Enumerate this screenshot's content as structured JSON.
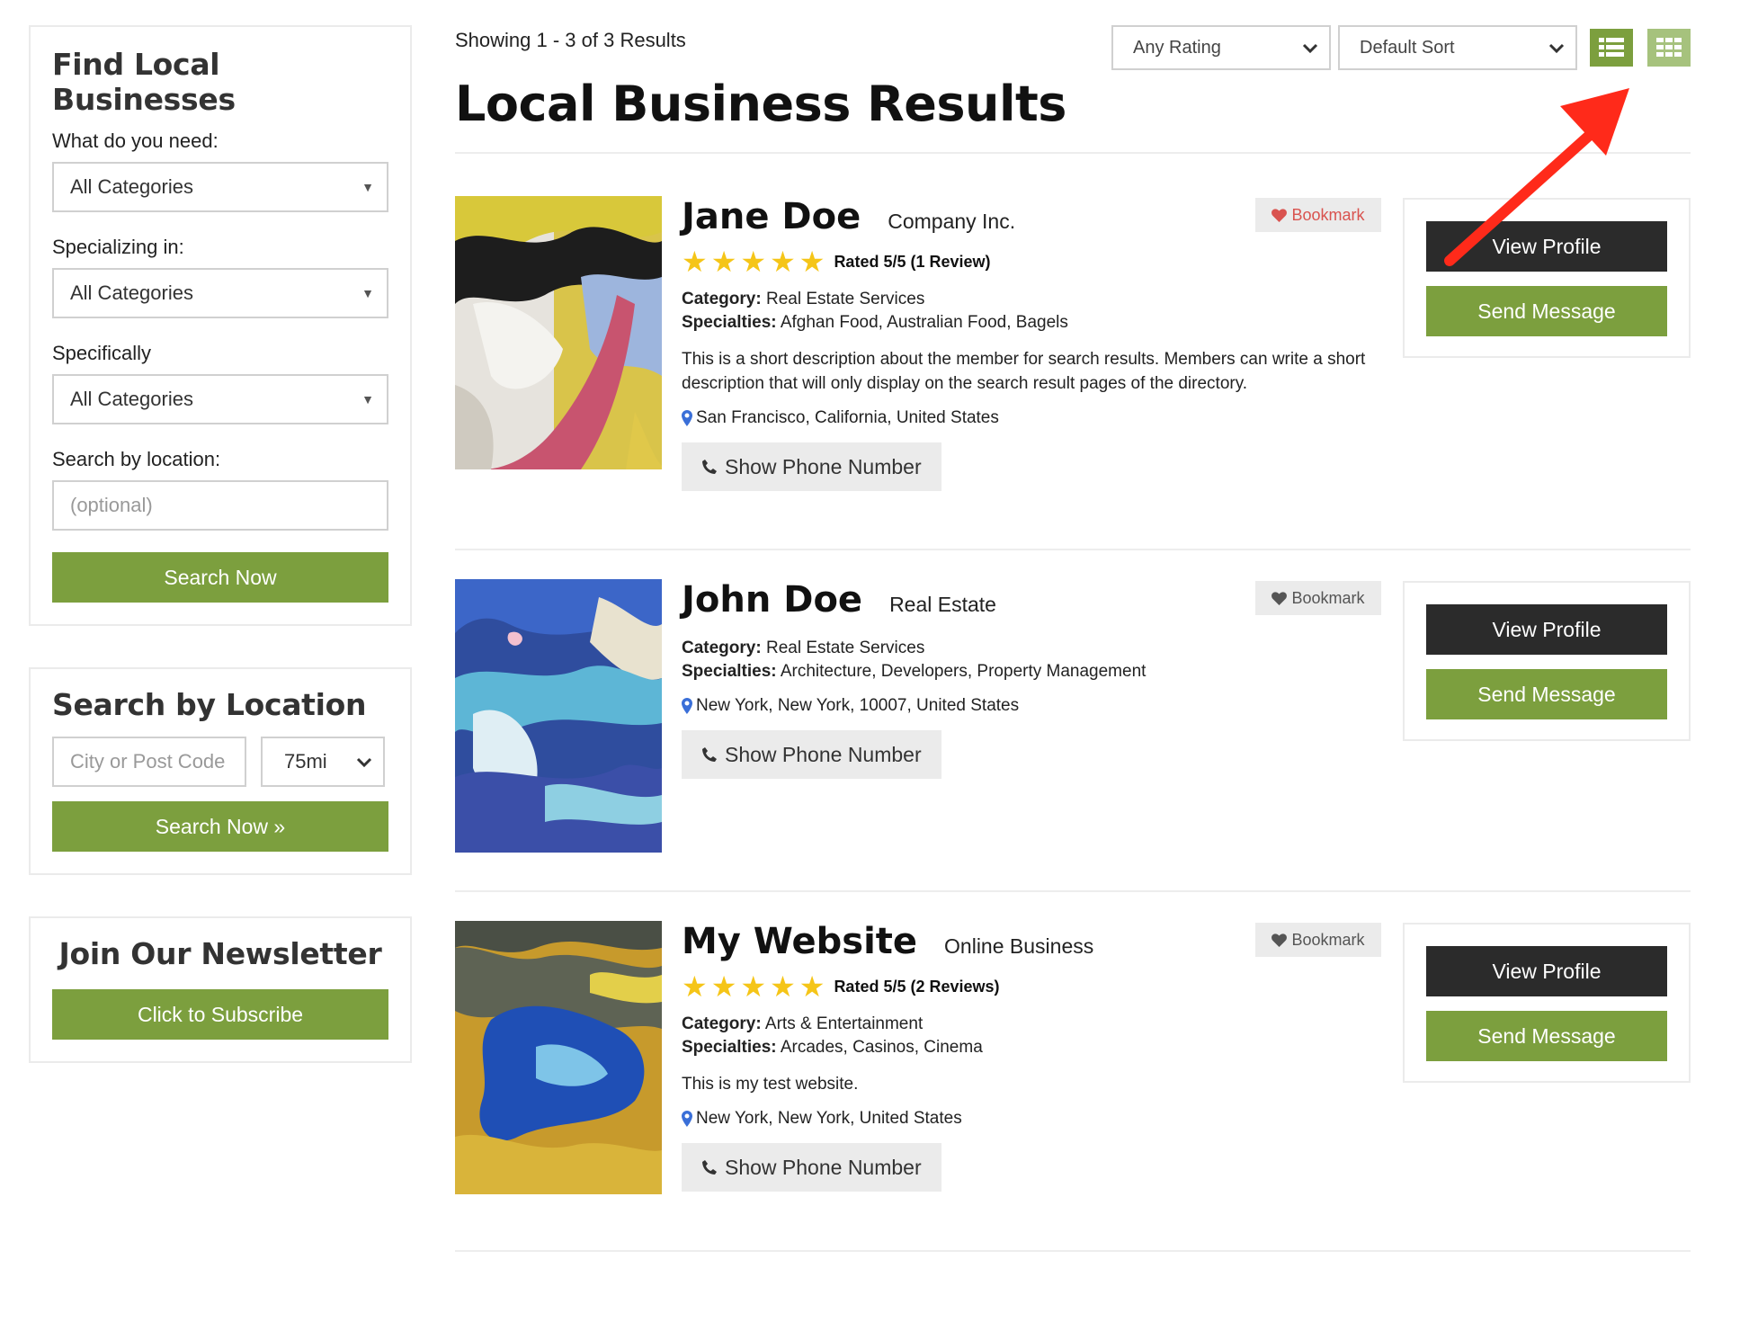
{
  "sidebar": {
    "find": {
      "title": "Find Local Businesses",
      "need_label": "What do you need:",
      "need_value": "All Categories",
      "specializing_label": "Specializing in:",
      "specializing_value": "All Categories",
      "specifically_label": "Specifically",
      "specifically_value": "All Categories",
      "location_label": "Search by location:",
      "location_placeholder": "(optional)",
      "search_button": "Search Now"
    },
    "location": {
      "title": "Search by Location",
      "city_placeholder": "City or Post Code",
      "distance_value": "75mi",
      "search_button": "Search Now »"
    },
    "newsletter": {
      "title": "Join Our Newsletter",
      "subscribe_button": "Click to Subscribe"
    }
  },
  "main": {
    "showing": "Showing 1 - 3 of 3 Results",
    "title": "Local Business Results",
    "rating_filter": "Any Rating",
    "sort_filter": "Default Sort"
  },
  "results": [
    {
      "name": "Jane Doe",
      "company": "Company Inc.",
      "rating_text": "Rated 5/5 (1 Review)",
      "stars": 5,
      "category_label": "Category:",
      "category": "Real Estate Services",
      "specialties_label": "Specialties:",
      "specialties": "Afghan Food, Australian Food, Bagels",
      "description": "This is a short description about the member for search results. Members can write a short description that will only display on the search result pages of the directory.",
      "location": "San Francisco, California, United States",
      "phone_button": "Show Phone Number",
      "bookmark": "Bookmark",
      "view_profile": "View Profile",
      "send_message": "Send Message"
    },
    {
      "name": "John Doe",
      "company": "Real Estate",
      "category_label": "Category:",
      "category": "Real Estate Services",
      "specialties_label": "Specialties:",
      "specialties": "Architecture, Developers, Property Management",
      "location": "New York, New York, 10007, United States",
      "phone_button": "Show Phone Number",
      "bookmark": "Bookmark",
      "view_profile": "View Profile",
      "send_message": "Send Message"
    },
    {
      "name": "My Website",
      "company": "Online Business",
      "rating_text": "Rated 5/5 (2 Reviews)",
      "stars": 5,
      "category_label": "Category:",
      "category": "Arts & Entertainment",
      "specialties_label": "Specialties:",
      "specialties": "Arcades, Casinos, Cinema",
      "description": "This is my test website.",
      "location": "New York, New York, United States",
      "phone_button": "Show Phone Number",
      "bookmark": "Bookmark",
      "view_profile": "View Profile",
      "send_message": "Send Message"
    }
  ],
  "colors": {
    "accent_green": "#7c9f3e",
    "dark_button": "#2b2b2b",
    "bookmark_active": "#d9534f",
    "star": "#f5c518",
    "annotation_arrow": "#ff2a1a"
  },
  "icons": [
    "list-view-icon",
    "grid-view-icon",
    "heart-icon",
    "map-pin-icon",
    "phone-icon",
    "star-icon",
    "chevron-down-icon"
  ]
}
